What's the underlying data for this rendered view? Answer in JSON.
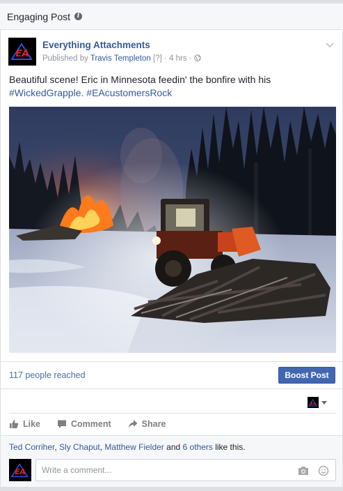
{
  "panel": {
    "title": "Engaging Post"
  },
  "post": {
    "page_name": "Everything Attachments",
    "published_by_prefix": "Published by",
    "publisher": "Travis Templeton",
    "question_mark": "[?]",
    "time": "4 hrs",
    "text_main": "Beautiful scene! Eric in Minnesota feedin' the bonfire with his",
    "hashtag1": "#WickedGrapple.",
    "hashtag2": "#EAcustomersRock",
    "logo_text": "EA"
  },
  "insights": {
    "reach": "117 people reached",
    "boost_label": "Boost Post"
  },
  "actions": {
    "like": "Like",
    "comment": "Comment",
    "share": "Share"
  },
  "likes": {
    "name1": "Ted Corriher",
    "name2": "Sly Chaput",
    "name3": "Matthew Fielder",
    "and_text": "and",
    "others": "6 others",
    "suffix": "like this."
  },
  "comment": {
    "placeholder": "Write a comment..."
  },
  "colors": {
    "link": "#365899",
    "boost_bg": "#4267b2",
    "fire": "#ff7a1a"
  }
}
